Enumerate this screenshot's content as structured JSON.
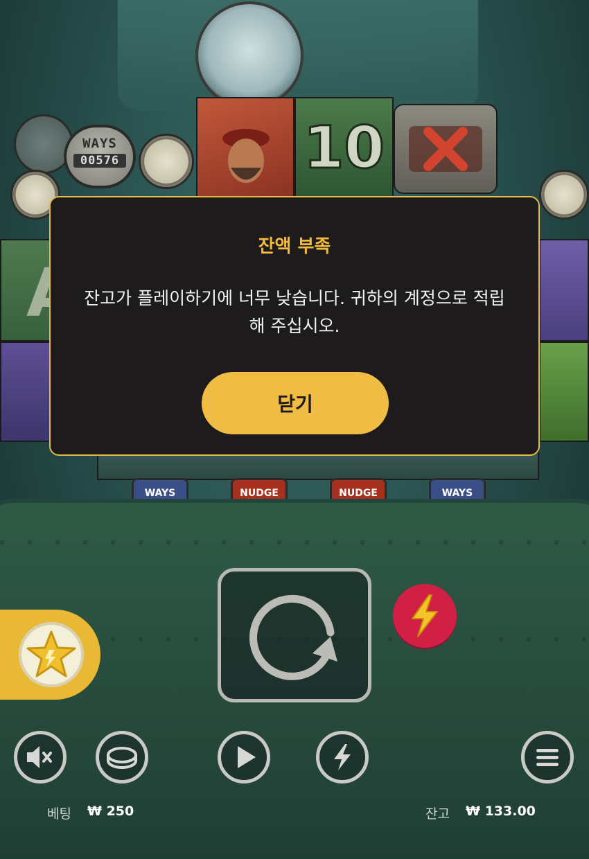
{
  "game": {
    "ways_label": "WAYS",
    "ways_count": "00576",
    "reel_top_number": "10",
    "badges": [
      "WAYS",
      "NUDGE",
      "NUDGE",
      "WAYS"
    ]
  },
  "dialog": {
    "title": "잔액 부족",
    "message": "잔고가 플레이하기에 너무 낮습니다. 귀하의 계정으로 적립해 주십시오.",
    "close_label": "닫기"
  },
  "footer": {
    "bet_label": "베팅",
    "bet_value": "₩ 250",
    "balance_label": "잔고",
    "balance_value": "₩ 133.00"
  },
  "colors": {
    "accent": "#f0bc44",
    "dialog_bg": "#1e1b1c",
    "turbo": "#d21f45"
  },
  "icons": {
    "spin": "spin-arrow-icon",
    "turbo": "lightning-icon",
    "feature": "star-icon",
    "sound": "sound-mute-icon",
    "coin": "coin-icon",
    "autoplay": "play-icon",
    "quick": "lightning-icon",
    "menu": "menu-icon"
  }
}
